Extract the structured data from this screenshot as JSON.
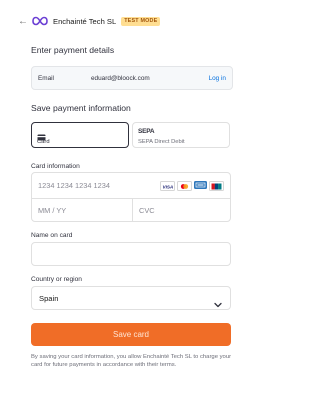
{
  "header": {
    "back_icon": "arrow-left-icon",
    "logo_icon": "infinity-logo-icon",
    "merchant_name": "Enchainté Tech SL",
    "badge": "TEST MODE",
    "badge_color": "#ffde92"
  },
  "contact": {
    "title": "Enter payment details",
    "email_label": "Email",
    "email_value": "eduard@bloock.com",
    "login_link": "Log in"
  },
  "payment": {
    "title": "Save payment information",
    "tabs": [
      {
        "label": "Card",
        "icon": "credit-card-icon",
        "selected": true
      },
      {
        "label": "SEPA Direct Debit",
        "logo_text": "SEPA",
        "selected": false
      }
    ],
    "card_info_label": "Card information",
    "card_number_placeholder": "1234 1234 1234 1234",
    "card_brands": [
      "VISA",
      "Mastercard",
      "American Express",
      "UnionPay"
    ],
    "expiry_placeholder": "MM / YY",
    "cvc_placeholder": "CVC",
    "name_label": "Name on card",
    "name_value": "",
    "country_label": "Country or region",
    "country_value": "Spain"
  },
  "actions": {
    "save_label": "Save card",
    "accent_color": "#f06d27"
  },
  "disclaimer": "By saving your card information, you allow Enchainté Tech SL to charge your card for future payments in accordance with their terms."
}
